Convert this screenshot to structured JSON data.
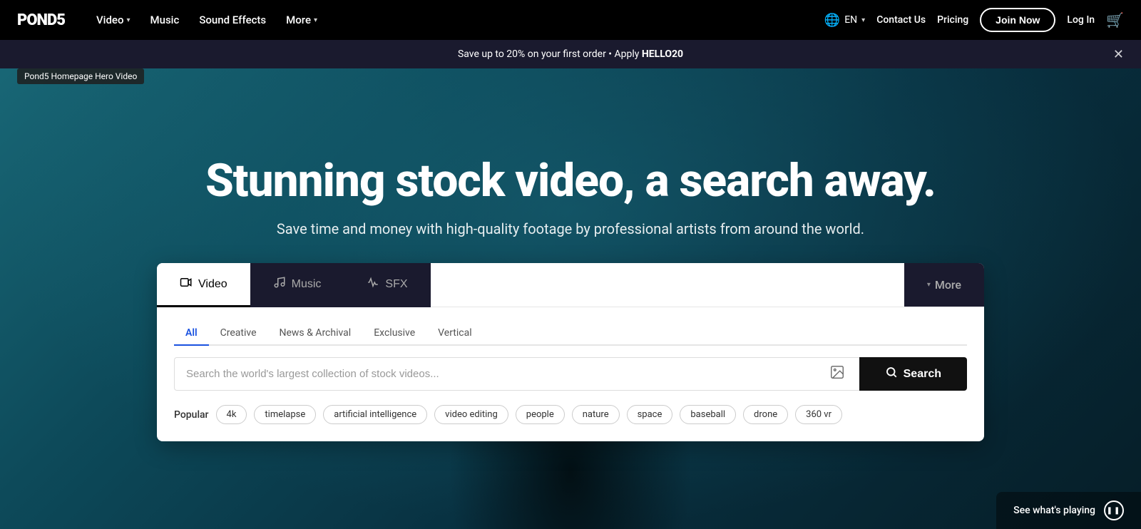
{
  "logo": {
    "text": "POND5"
  },
  "navbar": {
    "video_label": "Video",
    "music_label": "Music",
    "sound_effects_label": "Sound Effects",
    "more_label": "More",
    "lang": "EN",
    "contact_label": "Contact Us",
    "pricing_label": "Pricing",
    "join_label": "Join Now",
    "login_label": "Log In"
  },
  "promo_banner": {
    "text": "Save up to 20% on your first order • Apply ",
    "code": "HELLO20"
  },
  "hero": {
    "title": "Stunning stock video, a search away.",
    "subtitle": "Save time and money with high-quality footage by professional artists from around the world."
  },
  "search_tabs": [
    {
      "id": "video",
      "icon": "🎥",
      "label": "Video",
      "active": true
    },
    {
      "id": "music",
      "icon": "🎵",
      "label": "Music",
      "active": false
    },
    {
      "id": "sfx",
      "icon": "🔊",
      "label": "SFX",
      "active": false
    }
  ],
  "search_more_label": "More",
  "filter_tabs": [
    {
      "label": "All",
      "active": true
    },
    {
      "label": "Creative",
      "active": false
    },
    {
      "label": "News & Archival",
      "active": false
    },
    {
      "label": "Exclusive",
      "active": false
    },
    {
      "label": "Vertical",
      "active": false
    }
  ],
  "search_input": {
    "placeholder": "Search the world's largest collection of stock videos...",
    "value": ""
  },
  "search_button_label": "Search",
  "popular": {
    "label": "Popular",
    "tags": [
      "4k",
      "timelapse",
      "artificial intelligence",
      "video editing",
      "people",
      "nature",
      "space",
      "baseball",
      "drone",
      "360 vr"
    ]
  },
  "video_tooltip": "Pond5 Homepage Hero Video",
  "bottom_bar": {
    "label": "See what's playing"
  }
}
